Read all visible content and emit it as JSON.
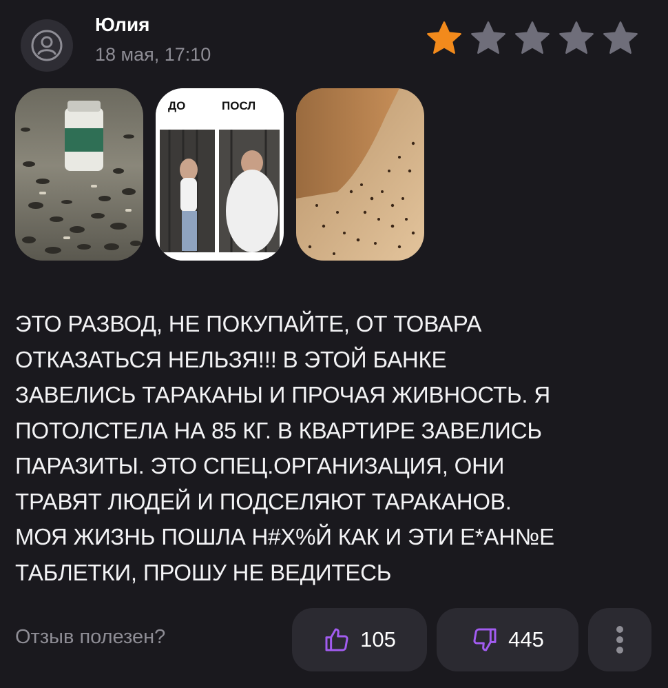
{
  "review": {
    "author": "Юлия",
    "date": "18 мая, 17:10",
    "rating": 1,
    "rating_max": 5,
    "photos": [
      {
        "icon": "photo-thumbnail-pills-cockroaches"
      },
      {
        "caption_before": "ДО",
        "caption_after": "ПОСЛ"
      },
      {
        "icon": "photo-thumbnail-insects-floor"
      }
    ],
    "text": "ЭТО РАЗВОД, НЕ ПОКУПАЙТЕ, ОТ ТОВАРА\nОТКАЗАТЬСЯ НЕЛЬЗЯ!!! В ЭТОЙ БАНКЕ\nЗАВЕЛИСЬ ТАРАКАНЫ И ПРОЧАЯ ЖИВНОСТЬ. Я\nПОТОЛСТЕЛА НА 85 КГ. В КВАРТИРЕ ЗАВЕЛИСЬ\nПАРАЗИТЫ. ЭТО СПЕЦ.ОРГАНИЗАЦИЯ, ОНИ\nТРАВЯТ ЛЮДЕЙ И ПОДСЕЛЯЮТ ТАРАКАНОВ.\nМОЯ ЖИЗНЬ ПОШЛА Н#Х%Й КАК И ЭТИ Е*АН№Е\nТАБЛЕТКИ, ПРОШУ НЕ ВЕДИТЕСЬ"
  },
  "feedback": {
    "question": "Отзыв полезен?",
    "likes": "105",
    "dislikes": "445"
  },
  "colors": {
    "background": "#1a191e",
    "button": "#2b2a31",
    "accent_purple": "#a25cf0",
    "star_active": "#f28a1c",
    "star_inactive": "#6f6e7a",
    "muted_text": "#8e8d95"
  }
}
